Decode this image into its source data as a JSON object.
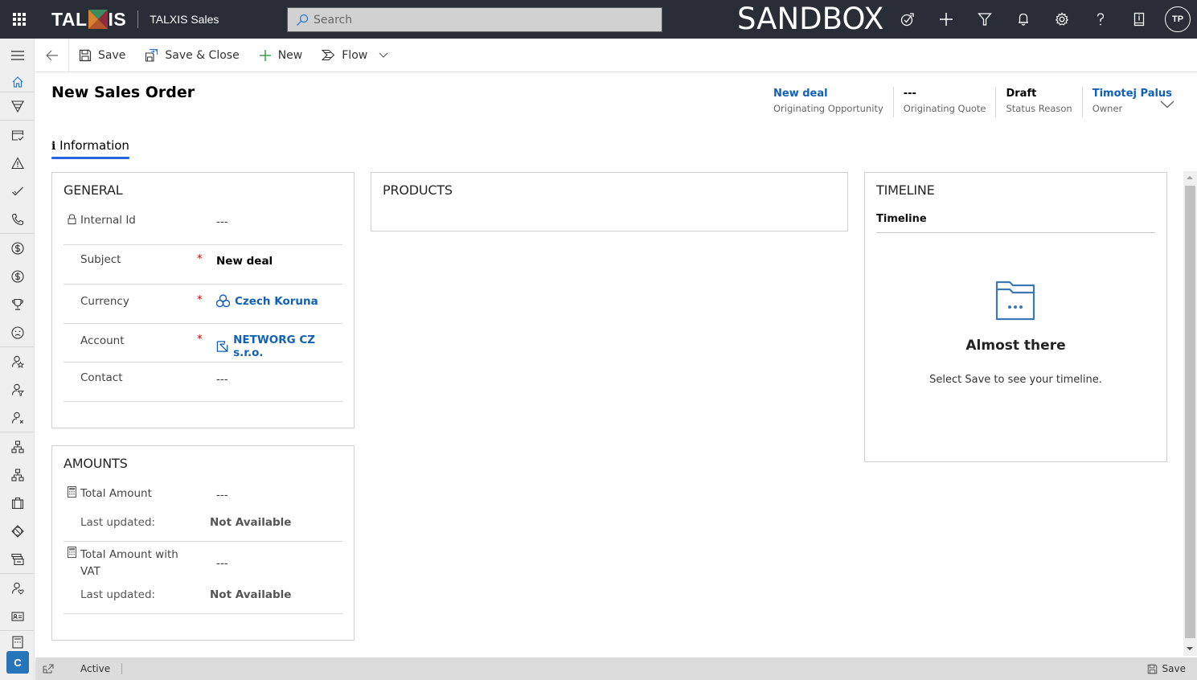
{
  "app": {
    "brand": "TALXIS",
    "brand_left": "TAL",
    "brand_right": "IS",
    "app_name": "TALXIS Sales",
    "environment": "SANDBOX",
    "user_initials": "TP"
  },
  "search": {
    "placeholder": "Search"
  },
  "top_icons": [
    "assistant-icon",
    "add-icon",
    "filter-icon",
    "notification-icon",
    "settings-icon",
    "help-icon",
    "info-icon"
  ],
  "sidebar": {
    "items": [
      {
        "name": "home-icon"
      },
      {
        "name": "funnel-icon"
      },
      {
        "name": "calendar-check-icon"
      },
      {
        "name": "warning-icon"
      },
      {
        "name": "checkmark-icon"
      },
      {
        "name": "phone-icon"
      },
      {
        "name": "dollar-icon"
      },
      {
        "name": "dollar-icon"
      },
      {
        "name": "trophy-icon"
      },
      {
        "name": "sad-face-icon"
      },
      {
        "name": "person-star-icon"
      },
      {
        "name": "person-filter-icon"
      },
      {
        "name": "person-x-icon"
      },
      {
        "name": "org-chart-icon"
      },
      {
        "name": "org-chart-icon"
      },
      {
        "name": "briefcase-icon"
      },
      {
        "name": "globe-icon"
      },
      {
        "name": "stacked-boxes-icon"
      },
      {
        "name": "person-heart-icon"
      },
      {
        "name": "contact-card-icon"
      },
      {
        "name": "calculator-icon"
      }
    ],
    "area_switcher": "C"
  },
  "commandbar": {
    "save": "Save",
    "save_close": "Save & Close",
    "new": "New",
    "flow": "Flow"
  },
  "form": {
    "title": "New Sales Order",
    "tab": "Information",
    "header_fields": [
      {
        "value": "New deal",
        "label": "Originating Opportunity",
        "link": true
      },
      {
        "value": "---",
        "label": "Originating Quote",
        "link": false
      },
      {
        "value": "Draft",
        "label": "Status Reason",
        "link": false
      },
      {
        "value": "Timotej Palus",
        "label": "Owner",
        "link": true
      }
    ]
  },
  "general": {
    "title": "GENERAL",
    "fields": [
      {
        "label": "Internal Id",
        "value": "---",
        "locked": true,
        "required": false
      },
      {
        "label": "Subject",
        "value": "New deal",
        "required": true
      },
      {
        "label": "Currency",
        "value": "Czech Koruna",
        "required": true,
        "lookup": true
      },
      {
        "label": "Account",
        "value": "NETWORG CZ s.r.o.",
        "required": true,
        "lookup": true
      },
      {
        "label": "Contact",
        "value": "---",
        "required": false
      }
    ]
  },
  "amounts": {
    "title": "AMOUNTS",
    "fields": [
      {
        "label": "Total Amount",
        "value": "---",
        "last_updated_label": "Last updated:",
        "last_updated_value": "Not Available"
      },
      {
        "label": "Total Amount with VAT",
        "label_line1": "Total Amount with",
        "label_line2": "VAT",
        "value": "---",
        "last_updated_label": "Last updated:",
        "last_updated_value": "Not Available"
      }
    ]
  },
  "products": {
    "title": "PRODUCTS"
  },
  "timeline": {
    "title": "TIMELINE",
    "subtitle": "Timeline",
    "empty_title": "Almost there",
    "empty_text": "Select Save to see your timeline."
  },
  "footer": {
    "status": "Active",
    "save": "Save"
  },
  "colors": {
    "topbar": "#292d35",
    "link": "#1160b7",
    "tab_accent": "#2266e3",
    "required": "#cc0000",
    "area_switcher": "#2774b8"
  }
}
